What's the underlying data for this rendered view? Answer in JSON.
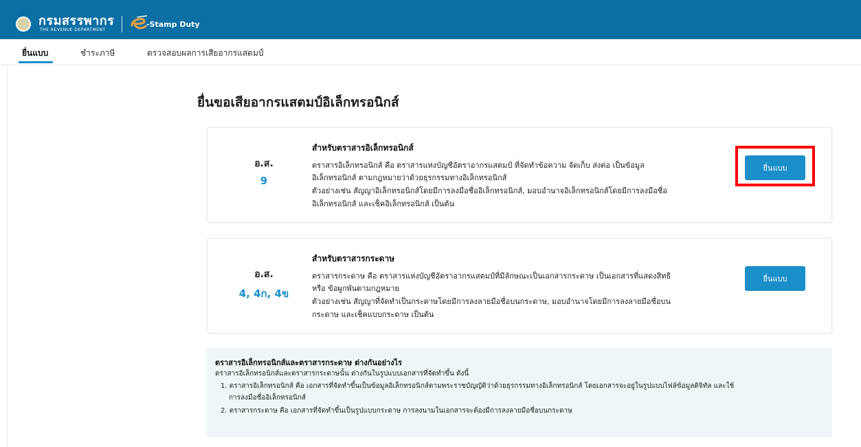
{
  "header": {
    "brand": "กรมสรรพากร",
    "brand_sub": "THE REVENUE DEPARTMENT",
    "app_name": "-Stamp Duty",
    "bg_color": "#0b6fa4"
  },
  "nav": {
    "tabs": [
      "ยื่นแบบ",
      "ชำระภาษี",
      "ตรวจสอบผลการเสียอากรแสตมป์"
    ],
    "active_index": 0
  },
  "page": {
    "title": "ยื่นขอเสียอากรแสตมป์อิเล็กทรอนิกส์"
  },
  "cards": [
    {
      "form_prefix": "อ.ส.",
      "form_code": "9",
      "heading": "สำหรับตราสารอิเล็กทรอนิกส์",
      "lines": [
        "ตราสารอิเล็กทรอนิกส์ คือ ตราสารแห่งบัญชีอัตราอากรแสตมป์ ที่จัดทำข้อความ จัดเก็บ ส่งต่อ เป็นข้อมูล",
        "อิเล็กทรอนิกส์ ตามกฎหมายว่าด้วยธุรกรรมทางอิเล็กทรอนิกส์",
        "ตัวอย่างเช่น สัญญาอิเล็กทรอนิกส์โดยมีการลงมือชื่ออิเล็กทรอนิกส์, มอบอำนาจอิเล็กทรอนิกส์โดยมีการลงมือชื่อ",
        "อิเล็กทรอนิกส์ และเช็คอิเล็กทรอนิกส์ เป็นต้น"
      ],
      "button_label": "ยื่นแบบ"
    },
    {
      "form_prefix": "อ.ส.",
      "form_code": "4, 4ก, 4ข",
      "heading": "สำหรับตราสารกระดาษ",
      "lines": [
        "ตราสารกระดาษ คือ ตราสารแห่งบัญชีอัตราอากรแสตมป์ที่มีลักษณะเป็นเอกสารกระดาษ เป็นเอกสารที่แสดงสิทธิ",
        "หรือ ข้อผูกพันตามกฎหมาย",
        "ตัวอย่างเช่น สัญญาที่จัดทำเป็นกระดาษโดยมีการลงลายมือชื่อบนกระดาษ, มอบอำนาจโดยมีการลงลายมือชื่อบน",
        "กระดาษ และเช็คแบบกระดาษ เป็นต้น"
      ],
      "button_label": "ยื่นแบบ"
    }
  ],
  "info": {
    "title": "ตราสารอิเล็กทรอนิกส์และตราสารกระดาษ ต่างกันอย่างไร",
    "intro": "ตราสารอิเล็กทรอนิกส์และตราสารกระดาษนั้น ต่างกันในรูปแบบเอกสารที่จัดทำขึ้น ดังนี้",
    "item1_line1": "1. ตราสารอิเล็กทรอนิกส์ คือ เอกสารที่จัดทำขึ้นเป็นข้อมูลอิเล็กทรอนิกส์ตามพระราชบัญญัติว่าด้วยธุรกรรมทางอิเล็กทรอนิกส์ โดยเอกสารจะอยู่ในรูปแบบไฟล์ข้อมูลดิจิทัล และใช้",
    "item1_line2": "การลงมือชื่ออิเล็กทรอนิกส์",
    "item2": "2. ตราสารกระดาษ คือ เอกสารที่จัดทำขึ้นเป็นรูปแบบกระดาษ การลงนามในเอกสารจะต้องมีการลงลายมือชื่อบนกระดาษ"
  },
  "colors": {
    "accent": "#1a8fc9",
    "highlight": "#ff0000",
    "info_bg": "#eef6f8"
  }
}
